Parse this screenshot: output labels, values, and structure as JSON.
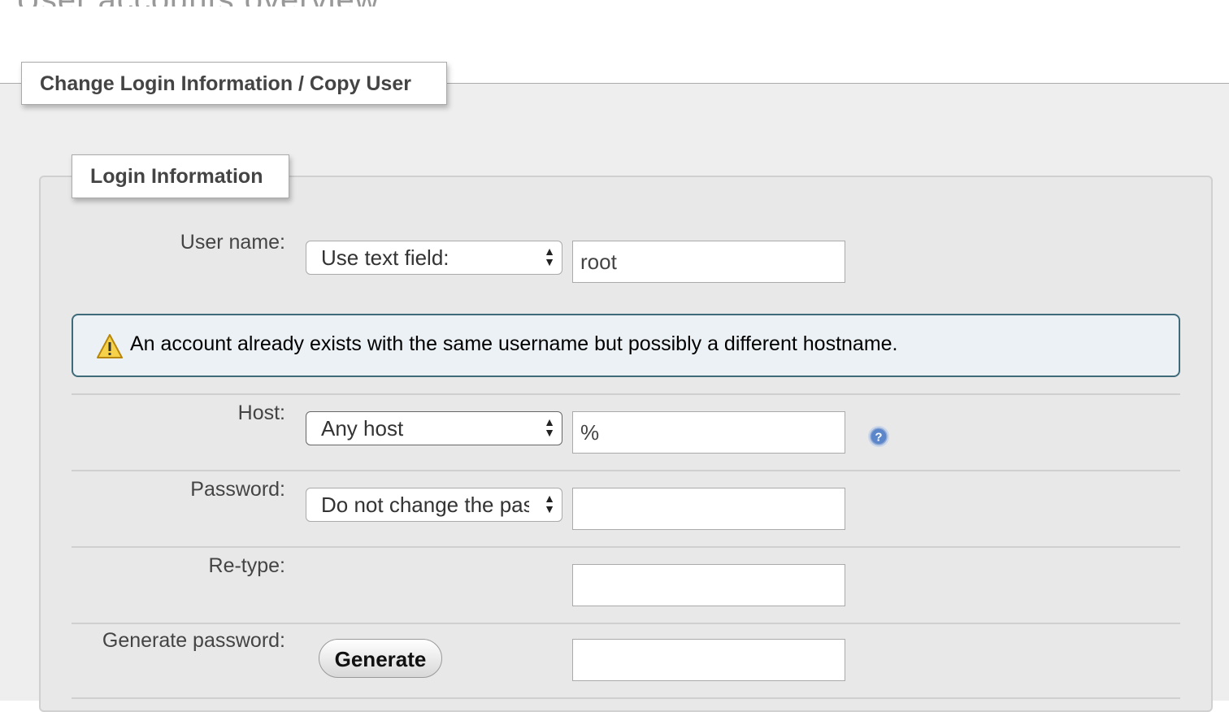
{
  "page_heading": "User accounts overview",
  "outer_legend": "Change Login Information / Copy User",
  "inner_legend": "Login Information",
  "username": {
    "label": "User name:",
    "select_value": "Use text field:",
    "input_value": "root"
  },
  "notice": {
    "icon": "warning-icon",
    "text": "An account already exists with the same username but possibly a different hostname."
  },
  "host": {
    "label": "Host:",
    "select_value": "Any host",
    "input_value": "%",
    "help_icon": "help-icon"
  },
  "password": {
    "label": "Password:",
    "select_value": "Do not change the password",
    "input_value": ""
  },
  "retype": {
    "label": "Re-type:",
    "input_value": ""
  },
  "generate": {
    "label": "Generate password:",
    "button_label": "Generate",
    "input_value": ""
  },
  "colors": {
    "notice_border": "#3e6a7a",
    "notice_bg": "#ebf1f4",
    "fieldset_bg": "#eeeeee"
  }
}
